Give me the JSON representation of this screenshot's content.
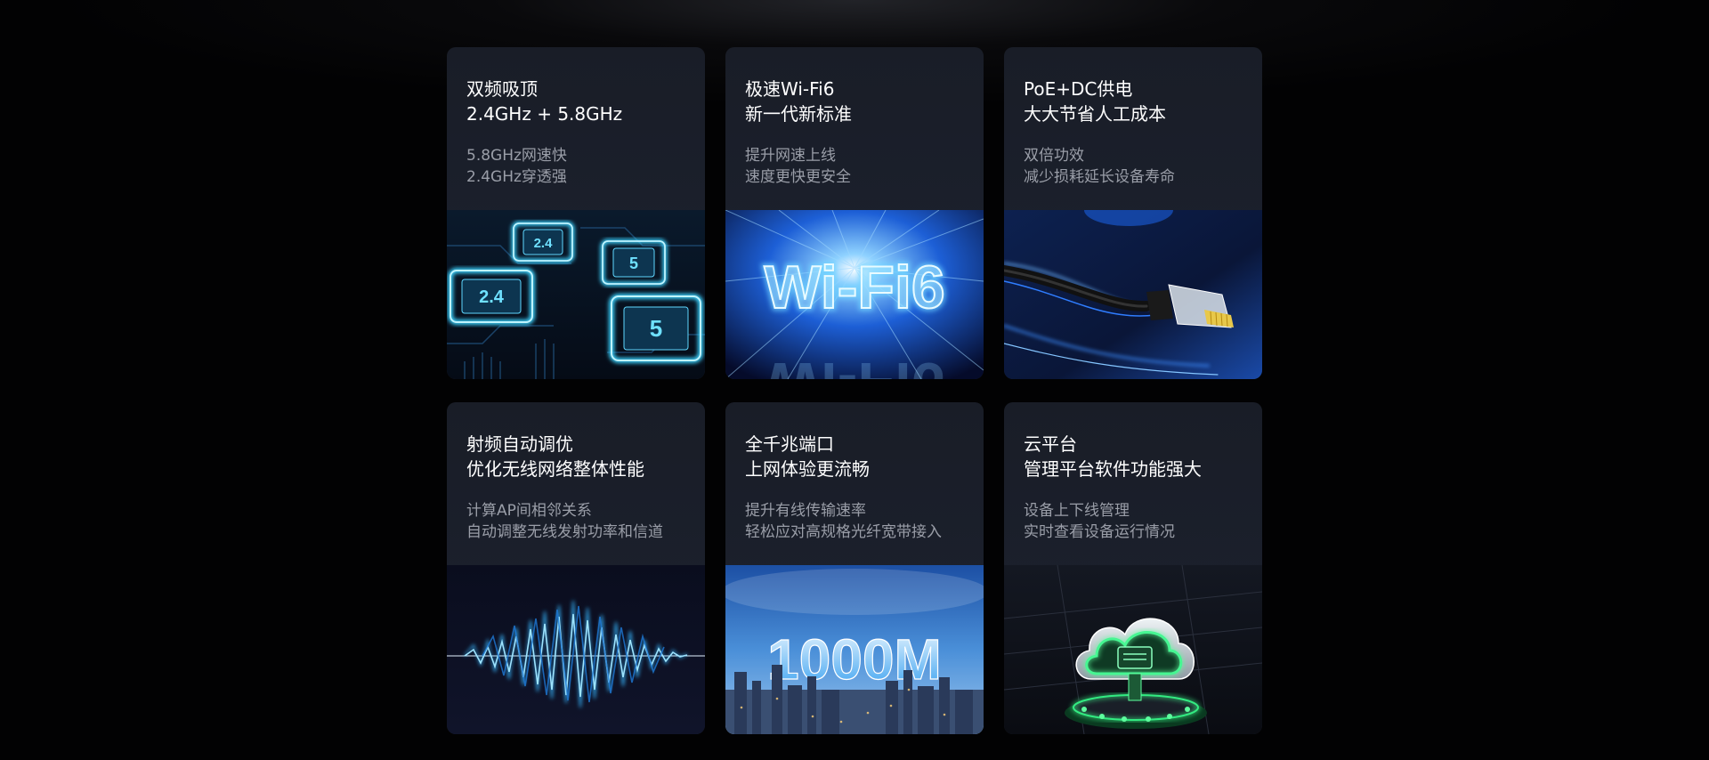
{
  "cards": [
    {
      "title_line1": "双频吸顶",
      "title_line2": "2.4GHz + 5.8GHz",
      "desc_line1": "5.8GHz网速快",
      "desc_line2": "2.4GHz穿透强",
      "image_icon": "dual-band-chip-image",
      "chip_labels": [
        "2.4",
        "5",
        "2.4",
        "5"
      ]
    },
    {
      "title_line1": "极速Wi-Fi6",
      "title_line2": "新一代新标准",
      "desc_line1": "提升网速上线",
      "desc_line2": "速度更快更安全",
      "image_icon": "wifi6-light-image",
      "image_text": "Wi-Fi6"
    },
    {
      "title_line1": "PoE+DC供电",
      "title_line2": "大大节省人工成本",
      "desc_line1": "双倍功效",
      "desc_line2": "减少损耗延长设备寿命",
      "image_icon": "ethernet-cable-image"
    },
    {
      "title_line1": "射频自动调优",
      "title_line2": "优化无线网络整体性能",
      "desc_line1": "计算AP间相邻关系",
      "desc_line2": "自动调整无线发射功率和信道",
      "image_icon": "radio-waveform-image"
    },
    {
      "title_line1": "全千兆端口",
      "title_line2": "上网体验更流畅",
      "desc_line1": "提升有线传输速率",
      "desc_line2": "轻松应对高规格光纤宽带接入",
      "image_icon": "gigabit-city-image",
      "image_text": "1000M"
    },
    {
      "title_line1": "云平台",
      "title_line2": "管理平台软件功能强大",
      "desc_line1": "设备上下线管理",
      "desc_line2": "实时查看设备运行情况",
      "image_icon": "cloud-platform-image"
    }
  ]
}
